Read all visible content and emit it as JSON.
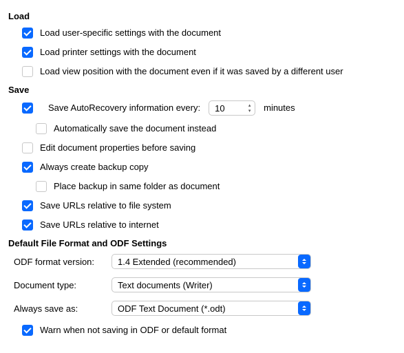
{
  "sections": {
    "load": {
      "title": "Load",
      "options": {
        "user_settings": {
          "label": "Load user-specific settings with the document",
          "checked": true
        },
        "printer_settings": {
          "label": "Load printer settings with the document",
          "checked": true
        },
        "view_position": {
          "label": "Load view position with the document even if it was saved by a different user",
          "checked": false
        }
      }
    },
    "save": {
      "title": "Save",
      "options": {
        "autorecovery": {
          "label_prefix": "Save AutoRecovery information every:",
          "value": "10",
          "label_suffix": "minutes",
          "checked": true
        },
        "auto_save_instead": {
          "label": "Automatically save the document instead",
          "checked": false
        },
        "edit_props": {
          "label": "Edit document properties before saving",
          "checked": false
        },
        "backup_copy": {
          "label": "Always create backup copy",
          "checked": true
        },
        "backup_same_folder": {
          "label": "Place backup in same folder as document",
          "checked": false
        },
        "urls_filesystem": {
          "label": "Save URLs relative to file system",
          "checked": true
        },
        "urls_internet": {
          "label": "Save URLs relative to internet",
          "checked": true
        }
      }
    },
    "format": {
      "title": "Default File Format and ODF Settings",
      "odf_version": {
        "label": "ODF format version:",
        "value": "1.4 Extended (recommended)"
      },
      "document_type": {
        "label": "Document type:",
        "value": "Text documents (Writer)"
      },
      "always_save_as": {
        "label": "Always save as:",
        "value": "ODF Text Document (*.odt)"
      },
      "warn_non_odf": {
        "label": "Warn when not saving in ODF or default format",
        "checked": true
      }
    }
  }
}
